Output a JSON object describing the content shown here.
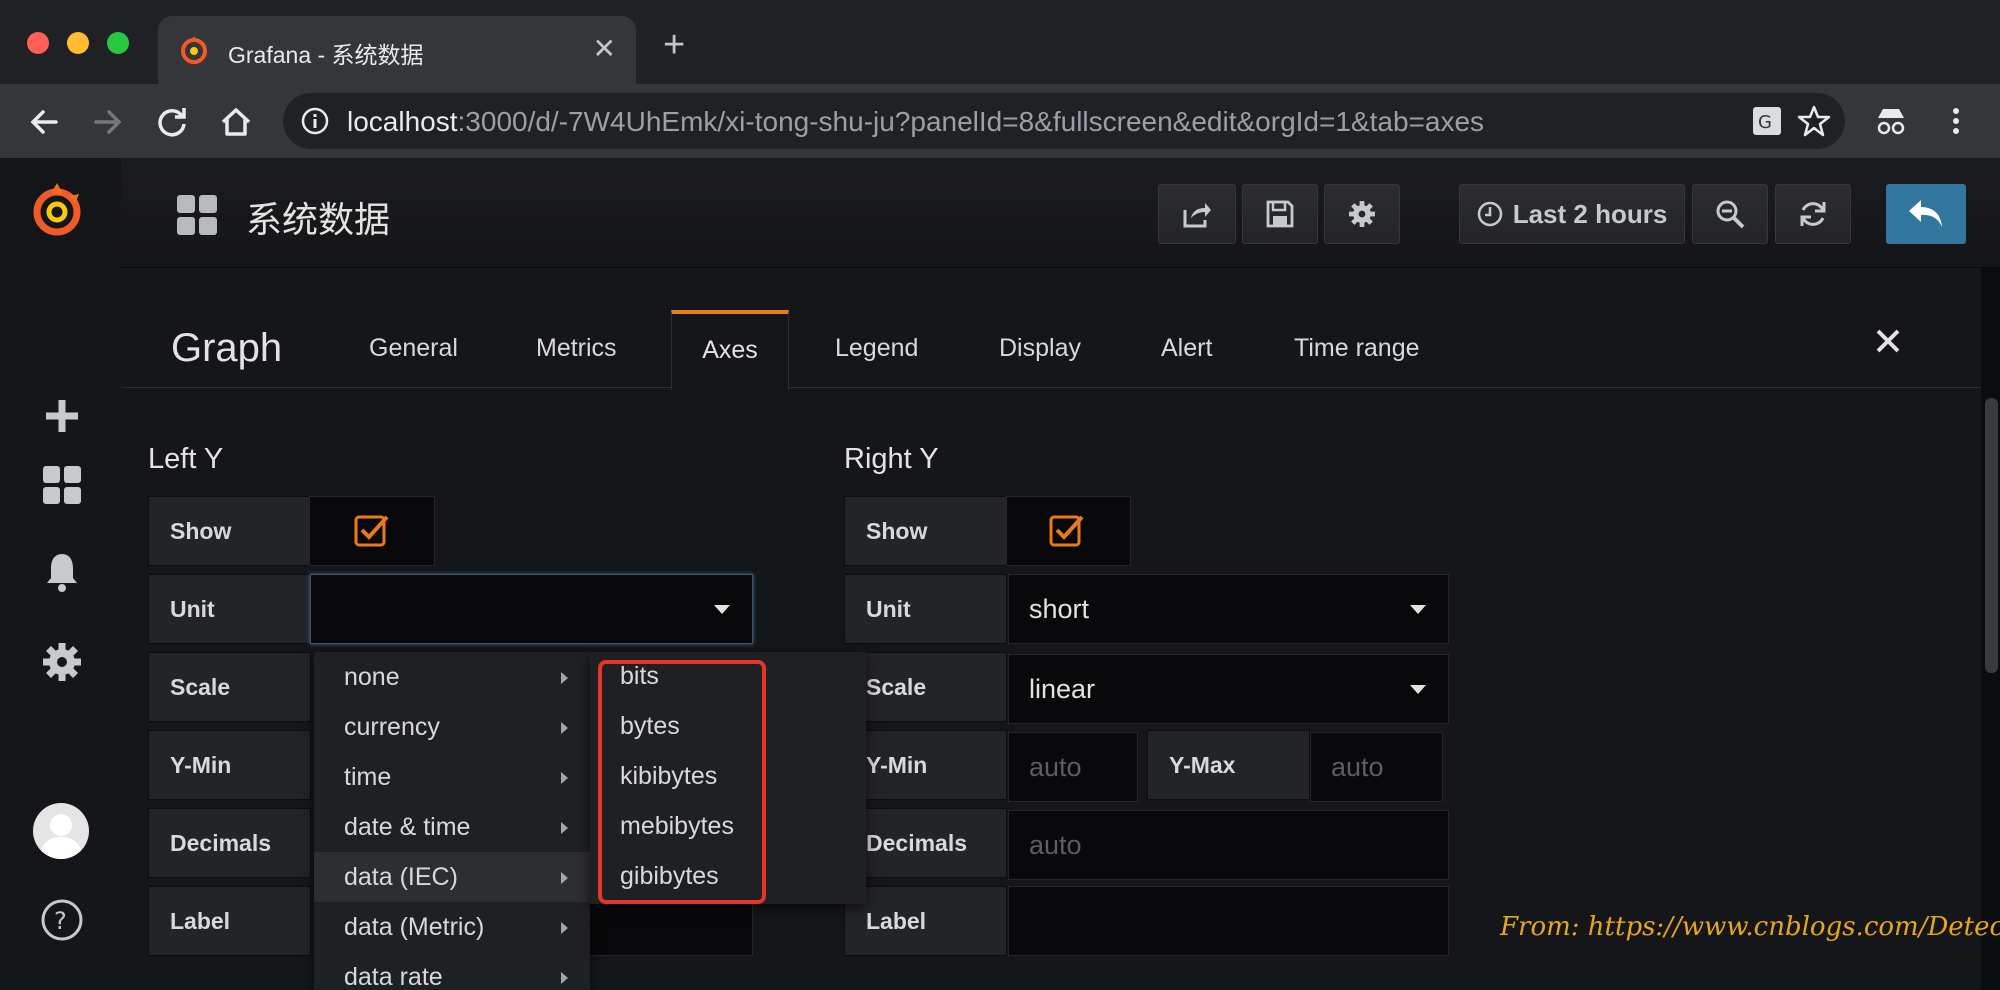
{
  "browser": {
    "tab_title": "Grafana - 系统数据",
    "url_host": "localhost",
    "url_rest": ":3000/d/-7W4UhEmk/xi-tong-shu-ju?panelId=8&fullscreen&edit&orgId=1&tab=axes"
  },
  "dashboard": {
    "title": "系统数据",
    "time_range_label": "Last 2 hours"
  },
  "editor": {
    "panel_type": "Graph",
    "tabs": [
      "General",
      "Metrics",
      "Axes",
      "Legend",
      "Display",
      "Alert",
      "Time range"
    ],
    "active_tab": "Axes"
  },
  "left_y": {
    "heading": "Left Y",
    "show_label": "Show",
    "unit_label": "Unit",
    "unit_value": "",
    "scale_label": "Scale",
    "ymin_label": "Y-Min",
    "decimals_label": "Decimals",
    "label_label": "Label"
  },
  "right_y": {
    "heading": "Right Y",
    "show_label": "Show",
    "unit_label": "Unit",
    "unit_value": "short",
    "scale_label": "Scale",
    "scale_value": "linear",
    "ymin_label": "Y-Min",
    "ymin_placeholder": "auto",
    "ymax_label": "Y-Max",
    "ymax_placeholder": "auto",
    "decimals_label": "Decimals",
    "decimals_placeholder": "auto",
    "label_label": "Label"
  },
  "unit_menu": {
    "categories": [
      "none",
      "currency",
      "time",
      "date & time",
      "data (IEC)",
      "data (Metric)",
      "data rate"
    ],
    "active_category": "data (IEC)",
    "submenu": [
      "bits",
      "bytes",
      "kibibytes",
      "mebibytes",
      "gibibytes"
    ]
  },
  "credit": "From: https://www.cnblogs.com/Detector/",
  "colors": {
    "accent_orange": "#eb7b18",
    "primary_blue": "#31769c",
    "highlight_red": "#e6342b",
    "credit_gold": "#e8a71b"
  }
}
